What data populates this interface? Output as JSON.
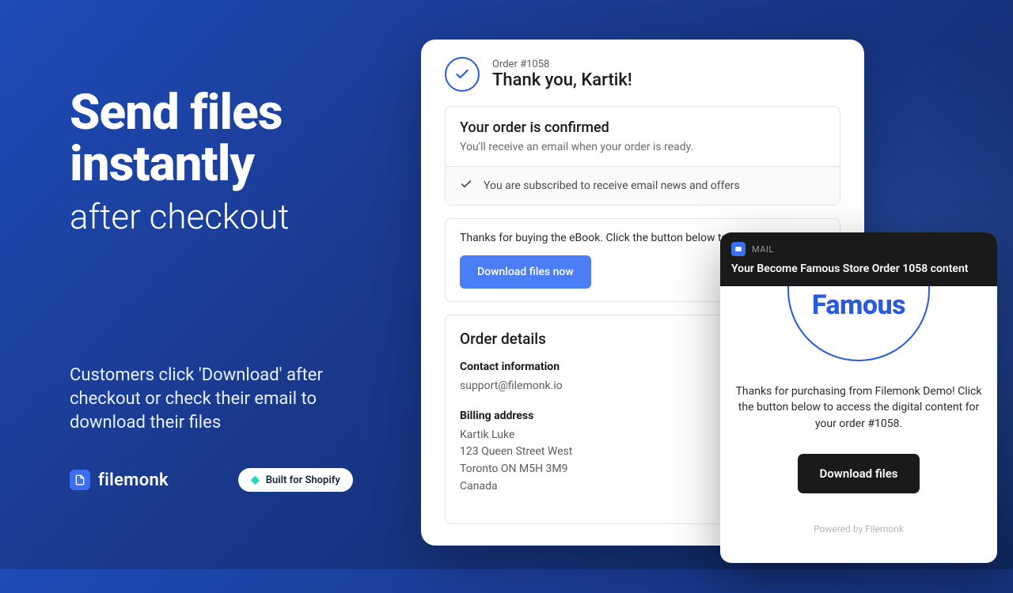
{
  "left": {
    "headline": "Send files instantly",
    "subhead": "after checkout",
    "desc": "Customers click 'Download' after checkout or check their email to download their files"
  },
  "brand": {
    "name": "filemonk",
    "shopify_badge": "Built for Shopify"
  },
  "checkout": {
    "order_label": "Order #1058",
    "thank_you": "Thank you, Kartik!",
    "confirm_title": "Your order is confirmed",
    "confirm_sub": "You'll receive an email when your order is ready.",
    "subscribe_msg": "You are subscribed to receive email news and offers",
    "download_msg": "Thanks for buying the eBook. Click the button below to",
    "download_btn": "Download files now",
    "details_title": "Order details",
    "contact_label": "Contact information",
    "contact_email": "support@filemonk.io",
    "billing_label": "Billing address",
    "billing_name": "Kartik Luke",
    "billing_street": "123 Queen Street West",
    "billing_city": "Toronto ON M5H 3M9",
    "billing_country": "Canada"
  },
  "email": {
    "mail_label": "MAIL",
    "subject": "Your Become Famous Store Order 1058 content",
    "logo": "Famous",
    "body": "Thanks for purchasing from Filemonk Demo! Click the button below to access the digital content for your order #1058.",
    "btn": "Download files",
    "powered": "Powered by Filemonk"
  }
}
